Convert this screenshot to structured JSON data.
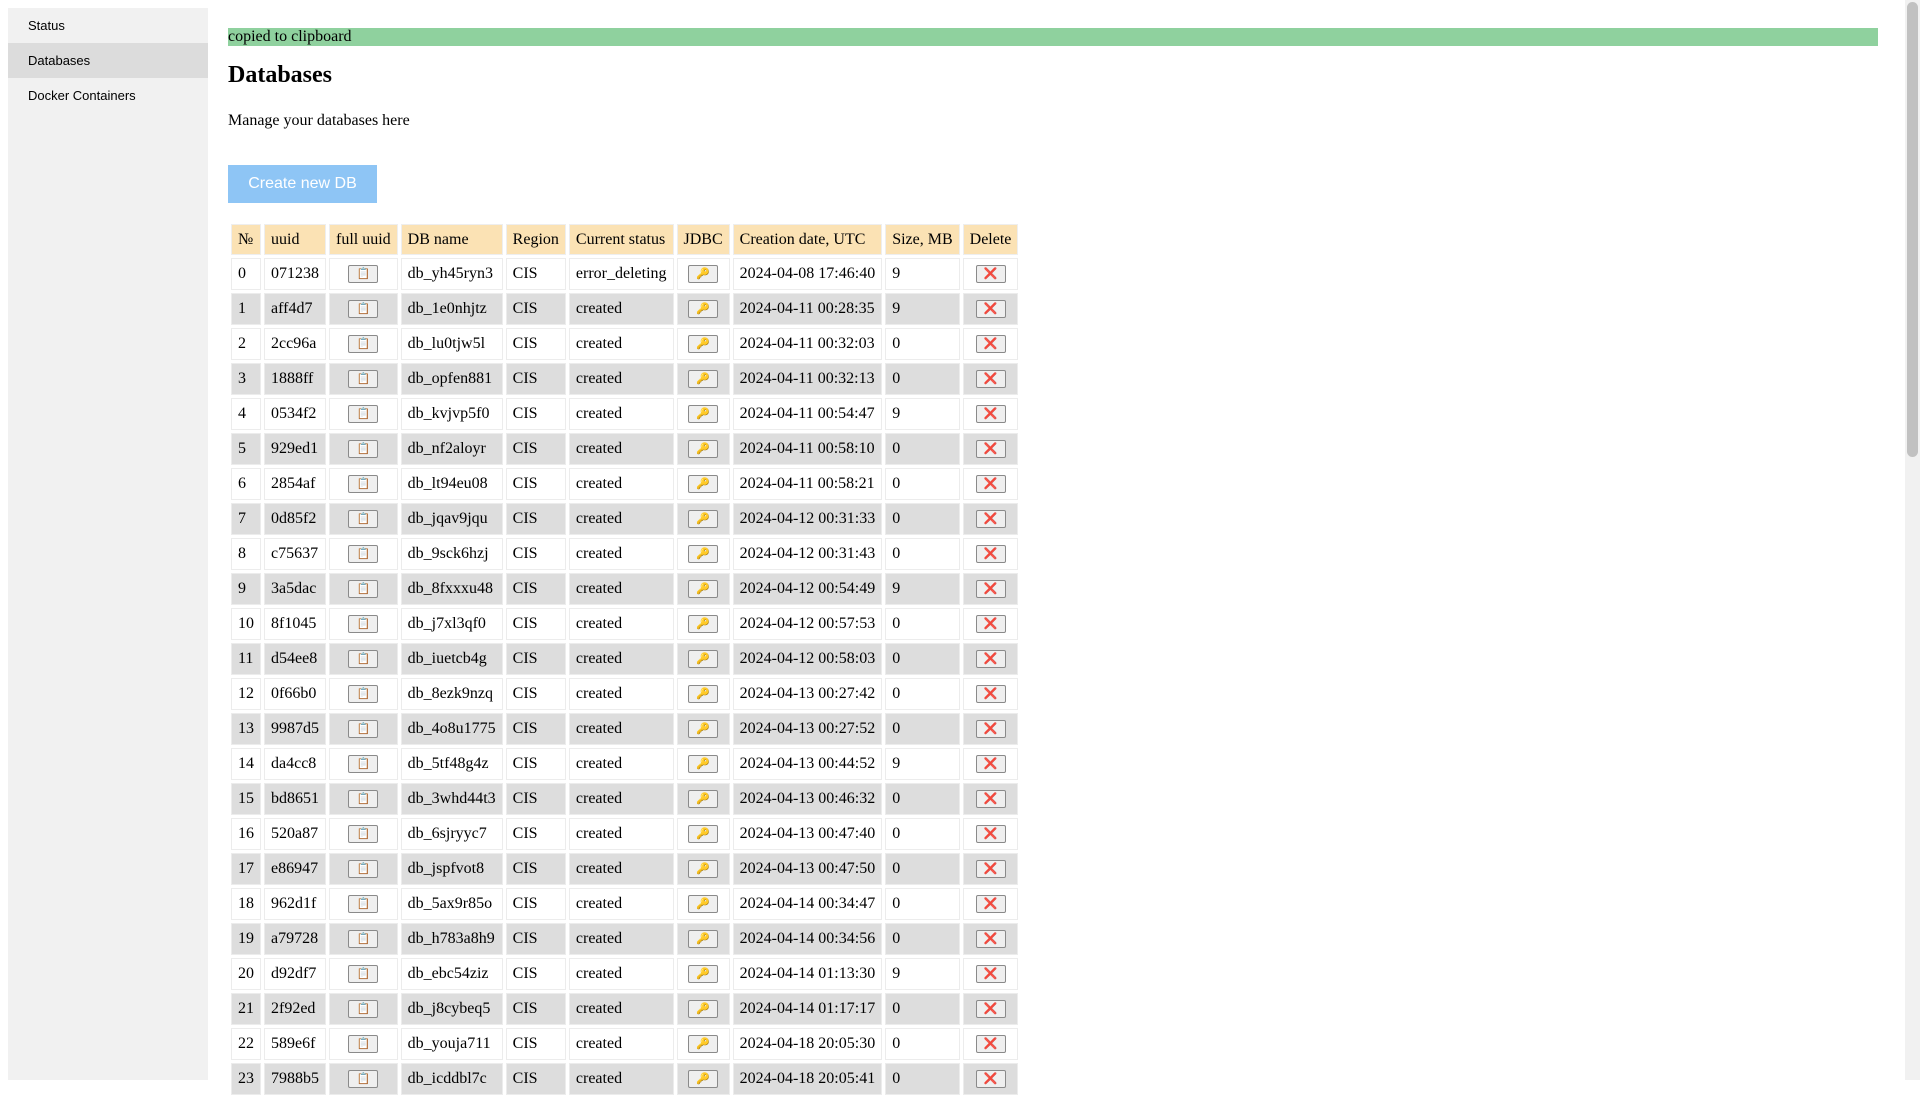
{
  "sidebar": {
    "items": [
      {
        "label": "Status",
        "active": false
      },
      {
        "label": "Databases",
        "active": true
      },
      {
        "label": "Docker Containers",
        "active": false
      }
    ]
  },
  "toast": {
    "text": "copied to clipboard",
    "color": "#8fd19e"
  },
  "page": {
    "title": "Databases",
    "subtitle": "Manage your databases here",
    "create_button": "Create new DB"
  },
  "table": {
    "headers": [
      "№",
      "uuid",
      "full uuid",
      "DB name",
      "Region",
      "Current status",
      "JDBC",
      "Creation date, UTC",
      "Size, MB",
      "Delete"
    ],
    "icons": {
      "copy": "📋",
      "key": "🔑",
      "delete": "❌"
    },
    "rows": [
      {
        "n": "0",
        "uuid": "071238",
        "name": "db_yh45ryn3",
        "region": "CIS",
        "status": "error_deleting",
        "date": "2024-04-08 17:46:40",
        "size": "9"
      },
      {
        "n": "1",
        "uuid": "aff4d7",
        "name": "db_1e0nhjtz",
        "region": "CIS",
        "status": "created",
        "date": "2024-04-11 00:28:35",
        "size": "9"
      },
      {
        "n": "2",
        "uuid": "2cc96a",
        "name": "db_lu0tjw5l",
        "region": "CIS",
        "status": "created",
        "date": "2024-04-11 00:32:03",
        "size": "0"
      },
      {
        "n": "3",
        "uuid": "1888ff",
        "name": "db_opfen881",
        "region": "CIS",
        "status": "created",
        "date": "2024-04-11 00:32:13",
        "size": "0"
      },
      {
        "n": "4",
        "uuid": "0534f2",
        "name": "db_kvjvp5f0",
        "region": "CIS",
        "status": "created",
        "date": "2024-04-11 00:54:47",
        "size": "9"
      },
      {
        "n": "5",
        "uuid": "929ed1",
        "name": "db_nf2aloyr",
        "region": "CIS",
        "status": "created",
        "date": "2024-04-11 00:58:10",
        "size": "0"
      },
      {
        "n": "6",
        "uuid": "2854af",
        "name": "db_lt94eu08",
        "region": "CIS",
        "status": "created",
        "date": "2024-04-11 00:58:21",
        "size": "0"
      },
      {
        "n": "7",
        "uuid": "0d85f2",
        "name": "db_jqav9jqu",
        "region": "CIS",
        "status": "created",
        "date": "2024-04-12 00:31:33",
        "size": "0"
      },
      {
        "n": "8",
        "uuid": "c75637",
        "name": "db_9sck6hzj",
        "region": "CIS",
        "status": "created",
        "date": "2024-04-12 00:31:43",
        "size": "0"
      },
      {
        "n": "9",
        "uuid": "3a5dac",
        "name": "db_8fxxxu48",
        "region": "CIS",
        "status": "created",
        "date": "2024-04-12 00:54:49",
        "size": "9"
      },
      {
        "n": "10",
        "uuid": "8f1045",
        "name": "db_j7xl3qf0",
        "region": "CIS",
        "status": "created",
        "date": "2024-04-12 00:57:53",
        "size": "0"
      },
      {
        "n": "11",
        "uuid": "d54ee8",
        "name": "db_iuetcb4g",
        "region": "CIS",
        "status": "created",
        "date": "2024-04-12 00:58:03",
        "size": "0"
      },
      {
        "n": "12",
        "uuid": "0f66b0",
        "name": "db_8ezk9nzq",
        "region": "CIS",
        "status": "created",
        "date": "2024-04-13 00:27:42",
        "size": "0"
      },
      {
        "n": "13",
        "uuid": "9987d5",
        "name": "db_4o8u1775",
        "region": "CIS",
        "status": "created",
        "date": "2024-04-13 00:27:52",
        "size": "0"
      },
      {
        "n": "14",
        "uuid": "da4cc8",
        "name": "db_5tf48g4z",
        "region": "CIS",
        "status": "created",
        "date": "2024-04-13 00:44:52",
        "size": "9"
      },
      {
        "n": "15",
        "uuid": "bd8651",
        "name": "db_3whd44t3",
        "region": "CIS",
        "status": "created",
        "date": "2024-04-13 00:46:32",
        "size": "0"
      },
      {
        "n": "16",
        "uuid": "520a87",
        "name": "db_6sjryyc7",
        "region": "CIS",
        "status": "created",
        "date": "2024-04-13 00:47:40",
        "size": "0"
      },
      {
        "n": "17",
        "uuid": "e86947",
        "name": "db_jspfvot8",
        "region": "CIS",
        "status": "created",
        "date": "2024-04-13 00:47:50",
        "size": "0"
      },
      {
        "n": "18",
        "uuid": "962d1f",
        "name": "db_5ax9r85o",
        "region": "CIS",
        "status": "created",
        "date": "2024-04-14 00:34:47",
        "size": "0"
      },
      {
        "n": "19",
        "uuid": "a79728",
        "name": "db_h783a8h9",
        "region": "CIS",
        "status": "created",
        "date": "2024-04-14 00:34:56",
        "size": "0"
      },
      {
        "n": "20",
        "uuid": "d92df7",
        "name": "db_ebc54ziz",
        "region": "CIS",
        "status": "created",
        "date": "2024-04-14 01:13:30",
        "size": "9"
      },
      {
        "n": "21",
        "uuid": "2f92ed",
        "name": "db_j8cybeq5",
        "region": "CIS",
        "status": "created",
        "date": "2024-04-14 01:17:17",
        "size": "0"
      },
      {
        "n": "22",
        "uuid": "589e6f",
        "name": "db_youja711",
        "region": "CIS",
        "status": "created",
        "date": "2024-04-18 20:05:30",
        "size": "0"
      },
      {
        "n": "23",
        "uuid": "7988b5",
        "name": "db_icddbl7c",
        "region": "CIS",
        "status": "created",
        "date": "2024-04-18 20:05:41",
        "size": "0"
      }
    ]
  }
}
